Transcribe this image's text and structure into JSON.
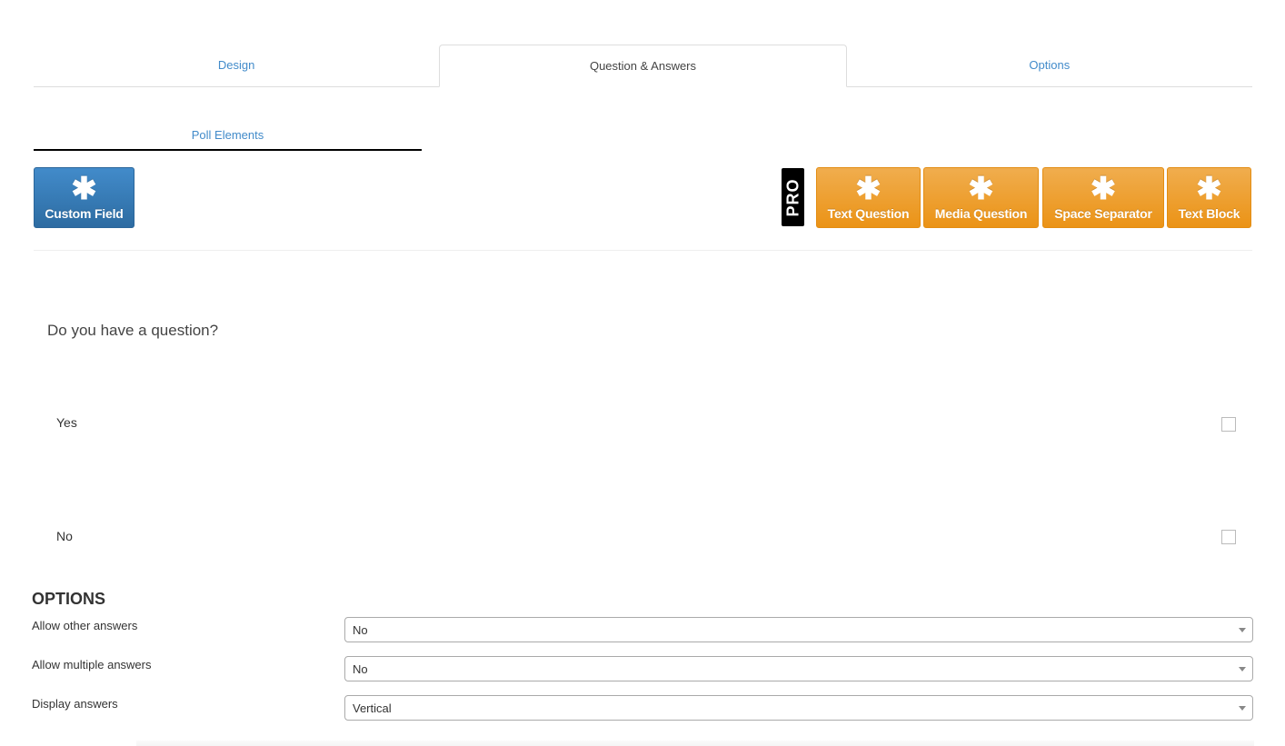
{
  "tabs": [
    {
      "label": "Design",
      "active": false
    },
    {
      "label": "Question & Answers",
      "active": true
    },
    {
      "label": "Options",
      "active": false
    }
  ],
  "subtab": {
    "label": "Poll Elements"
  },
  "elements": {
    "custom_field": {
      "label": "Custom Field",
      "icon": "asterisk-icon",
      "glyph": "✱"
    },
    "pro_badge": "PRO",
    "pro_items": [
      {
        "label": "Text Question",
        "glyph": "✱"
      },
      {
        "label": "Media Question",
        "glyph": "✱"
      },
      {
        "label": "Space Separator",
        "glyph": "✱"
      },
      {
        "label": "Text Block",
        "glyph": "✱"
      }
    ]
  },
  "poll": {
    "question": "Do you have a question?",
    "answers": [
      {
        "label": "Yes",
        "checked": false
      },
      {
        "label": "No",
        "checked": false
      }
    ]
  },
  "options": {
    "title": "OPTIONS",
    "fields": [
      {
        "label": "Allow other answers",
        "value": "No"
      },
      {
        "label": "Allow multiple answers",
        "value": "No"
      },
      {
        "label": "Display answers",
        "value": "Vertical"
      }
    ]
  },
  "colors": {
    "primary": "#428bca",
    "warning": "#f0ad4e"
  }
}
